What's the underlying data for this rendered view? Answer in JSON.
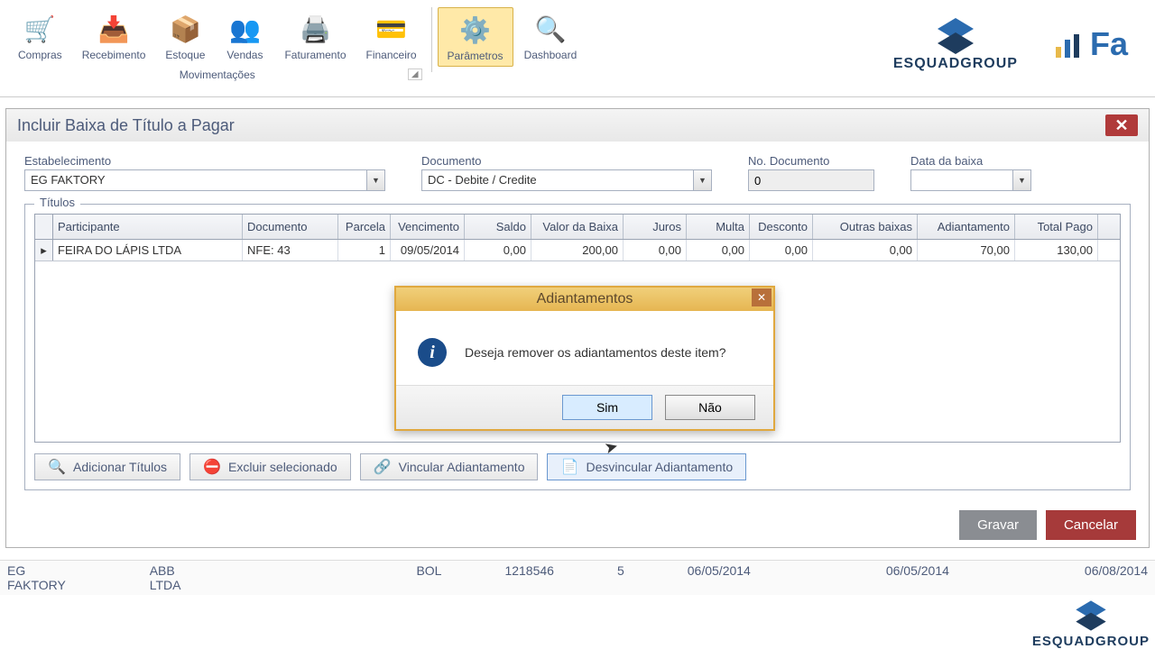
{
  "ribbon": {
    "items": [
      {
        "label": "Compras"
      },
      {
        "label": "Recebimento"
      },
      {
        "label": "Estoque"
      },
      {
        "label": "Vendas"
      },
      {
        "label": "Faturamento"
      },
      {
        "label": "Financeiro"
      },
      {
        "label": "Parâmetros"
      },
      {
        "label": "Dashboard"
      }
    ],
    "group_label": "Movimentações"
  },
  "childWindow": {
    "title": "Incluir Baixa de Título a Pagar"
  },
  "form": {
    "estabelecimento": {
      "label": "Estabelecimento",
      "value": "EG FAKTORY"
    },
    "documento": {
      "label": "Documento",
      "value": "DC - Debite / Credite"
    },
    "no_documento": {
      "label": "No. Documento",
      "value": "0"
    },
    "data_baixa": {
      "label": "Data da baixa",
      "value": ""
    }
  },
  "titulos": {
    "legend": "Títulos",
    "headers": [
      "Participante",
      "Documento",
      "Parcela",
      "Vencimento",
      "Saldo",
      "Valor da Baixa",
      "Juros",
      "Multa",
      "Desconto",
      "Outras baixas",
      "Adiantamento",
      "Total Pago"
    ],
    "rows": [
      {
        "participante": "FEIRA DO LÁPIS LTDA",
        "documento": "NFE: 43",
        "parcela": "1",
        "vencimento": "09/05/2014",
        "saldo": "0,00",
        "valor_baixa": "200,00",
        "juros": "0,00",
        "multa": "0,00",
        "desconto": "0,00",
        "outras_baixas": "0,00",
        "adiantamento": "70,00",
        "total_pago": "130,00"
      }
    ]
  },
  "buttons": {
    "adicionar": "Adicionar Títulos",
    "excluir": "Excluir selecionado",
    "vincular": "Vincular Adiantamento",
    "desvincular": "Desvincular Adiantamento",
    "gravar": "Gravar",
    "cancelar": "Cancelar"
  },
  "dialog": {
    "title": "Adiantamentos",
    "message": "Deseja remover os adiantamentos deste item?",
    "sim": "Sim",
    "nao": "Não"
  },
  "statusRow": {
    "c1": "EG FAKTORY",
    "c2": "ABB LTDA",
    "c3": "BOL",
    "c4": "1218546",
    "c5": "5",
    "c6": "06/05/2014",
    "c7": "06/05/2014",
    "c8": "06/08/2014"
  },
  "brand": {
    "name": "ESQUADGROUP",
    "fa": "Fa"
  }
}
